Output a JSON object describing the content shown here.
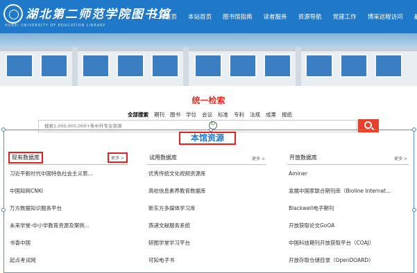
{
  "header": {
    "logo_cn": "湖北第二师范学院图书馆",
    "logo_en": "HUBEI UNIVERSITY OF EDUCATION LIBRARY",
    "nav": [
      "二师首页",
      "本站首页",
      "图书馆指南",
      "读者服务",
      "资源导航",
      "党建工作",
      "博采远程访问",
      "最新消息"
    ]
  },
  "search": {
    "title": "统一检索",
    "tabs": [
      "全部搜索",
      "期刊",
      "图书",
      "学位",
      "会议",
      "标准",
      "专利",
      "法规",
      "成果",
      "报纸"
    ],
    "active_tab": "全部搜索",
    "placeholder": "搜索1,000,000,000+条中外专业资源"
  },
  "section": {
    "title": "本馆资源"
  },
  "columns": [
    {
      "title": "现有数据库",
      "more": "更多 >",
      "items": [
        "习近平新时代中国特色社会主义思...",
        "中国知网CNKI",
        "万方数据知识服务平台",
        "未来学堂-中小学教育资源及案例...",
        "书香中国",
        "起点考试网"
      ]
    },
    {
      "title": "试用数据库",
      "more": "更多 >",
      "items": [
        "优秀传统文化视频资源库",
        "高校信息素养教育数据库",
        "新东方多媒体学习库",
        "燕递文献服务系统",
        "研图学堂学习平台",
        "可知电子书"
      ]
    },
    {
      "title": "开放数据库",
      "more": "更多 >",
      "items": [
        "Aminer",
        "发展中国家联合期刊库（Bioline Internat...",
        "Blackwell电子期刊",
        "开放获取论文GoOA",
        "中国科技期刊开放获取平台（COAJ）",
        "开放存取仓储目录（OpenDOARD）"
      ]
    }
  ],
  "colors": {
    "header_bg": "#1f78c8",
    "accent_red": "#d9302a",
    "search_button": "#e6412d"
  }
}
